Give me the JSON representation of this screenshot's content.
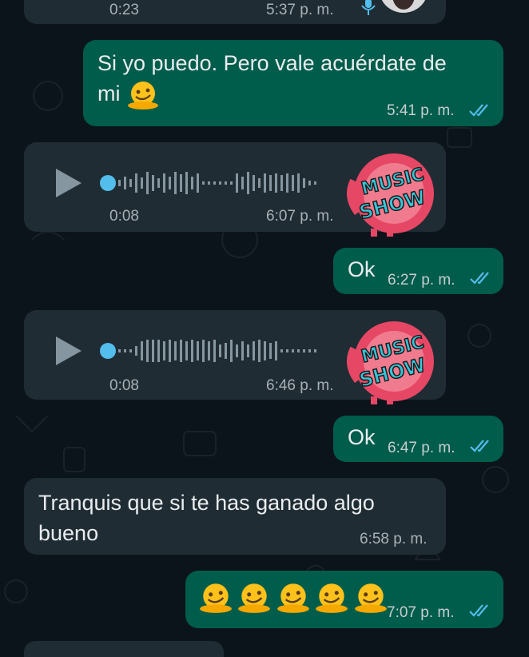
{
  "messages": [
    {
      "kind": "voice",
      "direction": "incoming",
      "duration": "0:23",
      "time": "5:37 p. m."
    },
    {
      "kind": "text",
      "direction": "outgoing",
      "text_line1": "Si yo puedo. Pero vale acuérdate de",
      "text_line2": "mi",
      "emoji": "melting-face",
      "time": "5:41 p. m.",
      "status": "read"
    },
    {
      "kind": "voice",
      "direction": "incoming",
      "duration": "0:08",
      "time": "6:07 p. m.",
      "avatar_text": "MUSIC SHOW"
    },
    {
      "kind": "text",
      "direction": "outgoing",
      "text": "Ok",
      "time": "6:27 p. m.",
      "status": "read"
    },
    {
      "kind": "voice",
      "direction": "incoming",
      "duration": "0:08",
      "time": "6:46 p. m.",
      "avatar_text": "MUSIC SHOW"
    },
    {
      "kind": "text",
      "direction": "outgoing",
      "text": "Ok",
      "time": "6:47 p. m.",
      "status": "read"
    },
    {
      "kind": "text",
      "direction": "incoming",
      "text_line1": "Tranquis que si te has ganado algo",
      "text_line2": "bueno",
      "time": "6:58 p. m."
    },
    {
      "kind": "emoji",
      "direction": "outgoing",
      "emoji": "melting-face",
      "count": 5,
      "time": "7:07 p. m.",
      "status": "read"
    }
  ],
  "colors": {
    "incoming": "#202c33",
    "outgoing": "#005c4b",
    "read_ticks": "#53bdeb",
    "background": "#0b141a"
  },
  "icons": {
    "play": "play-icon",
    "mic": "microphone-icon",
    "ticks": "double-check-icon"
  }
}
